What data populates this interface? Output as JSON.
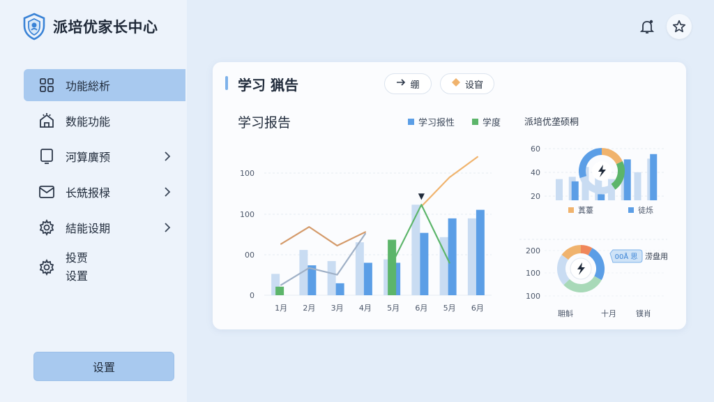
{
  "brand": {
    "name": "派培优家长中心",
    "logo_icon": "shield-logo-icon"
  },
  "sidebar": {
    "items": [
      {
        "label": "功能総析",
        "icon": "grid-icon",
        "active": true,
        "has_chevron": false
      },
      {
        "label": "数能功能",
        "icon": "house-icon",
        "active": false,
        "has_chevron": false
      },
      {
        "label": "河算廙预",
        "icon": "monitor-icon",
        "active": false,
        "has_chevron": true
      },
      {
        "label": "长兟报椂",
        "icon": "mail-icon",
        "active": false,
        "has_chevron": true
      },
      {
        "label": "結能设期",
        "icon": "gear-icon",
        "active": false,
        "has_chevron": true
      },
      {
        "label": "投贾设置",
        "icon": "gear-icon",
        "active": false,
        "has_chevron": false
      }
    ],
    "bottom_button": "设置"
  },
  "topbar": {
    "icons": [
      "bell-icon",
      "star-icon"
    ]
  },
  "card": {
    "title": "学习 猟告",
    "pills": [
      {
        "label": "绷",
        "icon": "arrow-right-icon"
      },
      {
        "label": "设窅",
        "icon": "diamond-icon"
      }
    ],
    "subtitle": "学习报告",
    "legend": [
      {
        "label": "学习报性",
        "color": "#5b9ee6"
      },
      {
        "label": "学度",
        "color": "#5cb56a"
      }
    ],
    "right_title": "派培优垄硕桐"
  },
  "colors": {
    "accent": "#a8c9ef",
    "bar_blue": "#5b9ee6",
    "bar_light": "#c9dcf2",
    "green": "#5cb56a",
    "orange": "#f0b36d",
    "brown": "#d49a6a",
    "gray_line": "#9fb0c6"
  },
  "chart_data": [
    {
      "type": "bar",
      "title": "学习报告",
      "categories": [
        "1月",
        "2月",
        "3月",
        "4月",
        "5月",
        "6月",
        "5月",
        "6月"
      ],
      "y_tick_labels": [
        "0",
        "00",
        "100",
        "100"
      ],
      "series": [
        {
          "name": "学习报性",
          "values": [
            null,
            35,
            14,
            38,
            38,
            73,
            90,
            100
          ],
          "color": "#5b9ee6"
        },
        {
          "name": "",
          "values": [
            25,
            53,
            40,
            62,
            42,
            106,
            68,
            90
          ],
          "color": "#c9dcf2"
        },
        {
          "name": "学度",
          "values": [
            10,
            null,
            null,
            null,
            65,
            null,
            null,
            null
          ],
          "color": "#5cb56a"
        }
      ],
      "lines": [
        {
          "name": "",
          "values": [
            60,
            80,
            58,
            74,
            null,
            null,
            null,
            null
          ],
          "color": "#d49a6a"
        },
        {
          "name": "",
          "values": [
            12,
            32,
            24,
            72,
            null,
            null,
            null,
            null
          ],
          "color": "#9fb0c6"
        },
        {
          "name": "",
          "values": [
            null,
            null,
            null,
            null,
            null,
            104,
            138,
            162
          ],
          "color": "#f0b36d"
        },
        {
          "name": "",
          "values": [
            null,
            null,
            null,
            null,
            40,
            106,
            38,
            null
          ],
          "color": "#5cb56a"
        }
      ],
      "marker": {
        "category_index": 5,
        "symbol": "▼"
      }
    },
    {
      "type": "bar",
      "title": "",
      "categories": [
        "",
        "",
        "",
        "",
        "",
        "",
        "",
        ""
      ],
      "y_tick_labels": [
        "60",
        "40",
        "20"
      ],
      "series": [
        {
          "name": "蒖薹",
          "values": [
            28,
            31,
            44,
            36,
            28,
            46,
            37,
            55
          ],
          "color": "#c9dcf2"
        },
        {
          "name": "徒烁",
          "values": [
            null,
            25,
            null,
            8,
            null,
            54,
            null,
            61
          ],
          "color": "#5b9ee6"
        }
      ],
      "donut": {
        "segments": [
          0.18,
          0.22,
          0.3,
          0.3
        ],
        "colors": [
          "#f0b36d",
          "#5cb56a",
          "#c9dcf2",
          "#5b9ee6"
        ]
      },
      "legend": [
        {
          "label": "蒖薹",
          "color": "#f0b36d"
        },
        {
          "label": "徒烁",
          "color": "#5b9ee6"
        }
      ]
    },
    {
      "type": "pie",
      "title": "",
      "x_labels": [
        "耼斛",
        "十月",
        "镤肖"
      ],
      "y_tick_labels": [
        "200",
        "100",
        "100"
      ],
      "segments": [
        {
          "label": "",
          "value": 0.08,
          "color": "#f0875a"
        },
        {
          "label": "",
          "value": 0.25,
          "color": "#5b9ee6"
        },
        {
          "label": "",
          "value": 0.3,
          "color": "#a8d9b8"
        },
        {
          "label": "",
          "value": 0.22,
          "color": "#c9dcf2"
        },
        {
          "label": "",
          "value": 0.15,
          "color": "#f0b36d"
        }
      ],
      "callout": {
        "badge": "00Å 思",
        "text": "涝盘用"
      }
    }
  ]
}
